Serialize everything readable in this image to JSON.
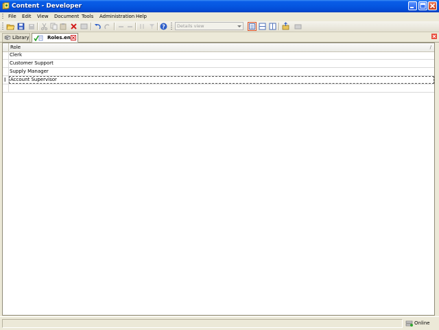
{
  "window": {
    "title": "Content - Developer"
  },
  "menu": {
    "items": [
      "File",
      "Edit",
      "View",
      "Document",
      "Tools",
      "Administration",
      "Help"
    ]
  },
  "toolbar": {
    "view_select_value": "Details view"
  },
  "tabs": [
    {
      "label": "Library",
      "active": false
    },
    {
      "label": "Roles.en",
      "active": true
    }
  ],
  "grid": {
    "header": "Role",
    "header_glyph": "/",
    "rows": [
      "Clerk",
      "Customer Support",
      "Supply Manager",
      "Account Supervisor",
      ""
    ],
    "edit_marker": "I"
  },
  "status": {
    "online_label": "Online"
  },
  "colors": {
    "titlebar": "#0556e0",
    "chrome": "#ece9d8",
    "active_tool_border": "#d7522a"
  }
}
